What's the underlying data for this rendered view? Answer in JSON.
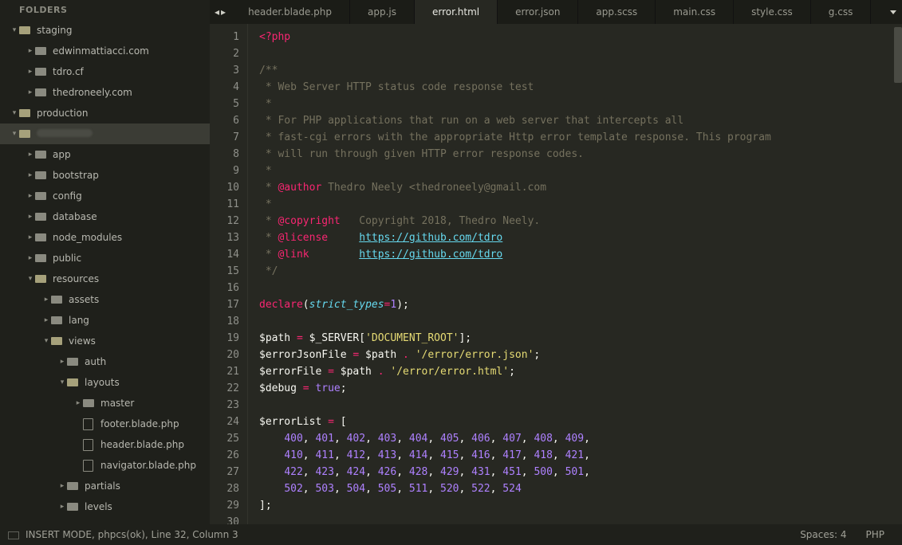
{
  "sidebar": {
    "header": "FOLDERS",
    "tree": [
      {
        "depth": 0,
        "type": "folder",
        "open": true,
        "label": "staging"
      },
      {
        "depth": 1,
        "type": "folder",
        "open": false,
        "label": "edwinmattiacci.com"
      },
      {
        "depth": 1,
        "type": "folder",
        "open": false,
        "label": "tdro.cf"
      },
      {
        "depth": 1,
        "type": "folder",
        "open": false,
        "label": "thedroneely.com"
      },
      {
        "depth": 0,
        "type": "folder",
        "open": true,
        "label": "production"
      },
      {
        "depth": 0,
        "type": "folder",
        "open": true,
        "label": "",
        "selected": true,
        "obscured": true
      },
      {
        "depth": 1,
        "type": "folder",
        "open": false,
        "label": "app"
      },
      {
        "depth": 1,
        "type": "folder",
        "open": false,
        "label": "bootstrap"
      },
      {
        "depth": 1,
        "type": "folder",
        "open": false,
        "label": "config"
      },
      {
        "depth": 1,
        "type": "folder",
        "open": false,
        "label": "database"
      },
      {
        "depth": 1,
        "type": "folder",
        "open": false,
        "label": "node_modules"
      },
      {
        "depth": 1,
        "type": "folder",
        "open": false,
        "label": "public"
      },
      {
        "depth": 1,
        "type": "folder",
        "open": true,
        "label": "resources"
      },
      {
        "depth": 2,
        "type": "folder",
        "open": false,
        "label": "assets"
      },
      {
        "depth": 2,
        "type": "folder",
        "open": false,
        "label": "lang"
      },
      {
        "depth": 2,
        "type": "folder",
        "open": true,
        "label": "views"
      },
      {
        "depth": 3,
        "type": "folder",
        "open": false,
        "label": "auth"
      },
      {
        "depth": 3,
        "type": "folder",
        "open": true,
        "label": "layouts"
      },
      {
        "depth": 4,
        "type": "folder",
        "open": false,
        "label": "master"
      },
      {
        "depth": 4,
        "type": "file",
        "label": "footer.blade.php"
      },
      {
        "depth": 4,
        "type": "file",
        "label": "header.blade.php"
      },
      {
        "depth": 4,
        "type": "file",
        "label": "navigator.blade.php"
      },
      {
        "depth": 3,
        "type": "folder",
        "open": false,
        "label": "partials"
      },
      {
        "depth": 3,
        "type": "folder",
        "open": false,
        "label": "levels"
      }
    ]
  },
  "tabs": {
    "nav_prev": "◂",
    "nav_next": "▸",
    "items": [
      {
        "label": "header.blade.php",
        "active": false
      },
      {
        "label": "app.js",
        "active": false
      },
      {
        "label": "error.html",
        "active": true
      },
      {
        "label": "error.json",
        "active": false
      },
      {
        "label": "app.scss",
        "active": false
      },
      {
        "label": "main.css",
        "active": false
      },
      {
        "label": "style.css",
        "active": false
      },
      {
        "label": "g.css",
        "active": false
      }
    ]
  },
  "code": {
    "first_line": 1,
    "lines": [
      [
        {
          "c": "c-tag",
          "t": "<?php"
        }
      ],
      [],
      [
        {
          "c": "c-cmt",
          "t": "/**"
        }
      ],
      [
        {
          "c": "c-cmt",
          "t": " * Web Server HTTP status code response test"
        }
      ],
      [
        {
          "c": "c-cmt",
          "t": " *"
        }
      ],
      [
        {
          "c": "c-cmt",
          "t": " * For PHP applications that run on a web server that intercepts all"
        }
      ],
      [
        {
          "c": "c-cmt",
          "t": " * fast-cgi errors with the appropriate Http error template response. This program"
        }
      ],
      [
        {
          "c": "c-cmt",
          "t": " * will run through given HTTP error response codes."
        }
      ],
      [
        {
          "c": "c-cmt",
          "t": " *"
        }
      ],
      [
        {
          "c": "c-cmt",
          "t": " * "
        },
        {
          "c": "c-doc",
          "t": "@author"
        },
        {
          "c": "c-cmt",
          "t": " Thedro Neely <thedroneely@gmail.com"
        }
      ],
      [
        {
          "c": "c-cmt",
          "t": " *"
        }
      ],
      [
        {
          "c": "c-cmt",
          "t": " * "
        },
        {
          "c": "c-doc",
          "t": "@copyright"
        },
        {
          "c": "c-cmt",
          "t": "   Copyright 2018, Thedro Neely."
        }
      ],
      [
        {
          "c": "c-cmt",
          "t": " * "
        },
        {
          "c": "c-doc",
          "t": "@license"
        },
        {
          "c": "c-cmt",
          "t": "     "
        },
        {
          "c": "c-link",
          "t": "https://github.com/tdro"
        }
      ],
      [
        {
          "c": "c-cmt",
          "t": " * "
        },
        {
          "c": "c-doc",
          "t": "@link"
        },
        {
          "c": "c-cmt",
          "t": "        "
        },
        {
          "c": "c-link",
          "t": "https://github.com/tdro"
        }
      ],
      [
        {
          "c": "c-cmt",
          "t": " */"
        }
      ],
      [],
      [
        {
          "c": "c-tag",
          "t": "declare"
        },
        {
          "c": "c-plain",
          "t": "("
        },
        {
          "c": "c-kw",
          "t": "strict_types"
        },
        {
          "c": "c-op",
          "t": "="
        },
        {
          "c": "c-num",
          "t": "1"
        },
        {
          "c": "c-plain",
          "t": ");"
        }
      ],
      [],
      [
        {
          "c": "c-plain",
          "t": "$path "
        },
        {
          "c": "c-op",
          "t": "="
        },
        {
          "c": "c-plain",
          "t": " $_SERVER["
        },
        {
          "c": "c-str",
          "t": "'DOCUMENT_ROOT'"
        },
        {
          "c": "c-plain",
          "t": "];"
        }
      ],
      [
        {
          "c": "c-plain",
          "t": "$errorJsonFile "
        },
        {
          "c": "c-op",
          "t": "="
        },
        {
          "c": "c-plain",
          "t": " $path "
        },
        {
          "c": "c-op",
          "t": "."
        },
        {
          "c": "c-plain",
          "t": " "
        },
        {
          "c": "c-str",
          "t": "'/error/error.json'"
        },
        {
          "c": "c-plain",
          "t": ";"
        }
      ],
      [
        {
          "c": "c-plain",
          "t": "$errorFile "
        },
        {
          "c": "c-op",
          "t": "="
        },
        {
          "c": "c-plain",
          "t": " $path "
        },
        {
          "c": "c-op",
          "t": "."
        },
        {
          "c": "c-plain",
          "t": " "
        },
        {
          "c": "c-str",
          "t": "'/error/error.html'"
        },
        {
          "c": "c-plain",
          "t": ";"
        }
      ],
      [
        {
          "c": "c-plain",
          "t": "$debug "
        },
        {
          "c": "c-op",
          "t": "="
        },
        {
          "c": "c-plain",
          "t": " "
        },
        {
          "c": "c-num",
          "t": "true"
        },
        {
          "c": "c-plain",
          "t": ";"
        }
      ],
      [],
      [
        {
          "c": "c-plain",
          "t": "$errorList "
        },
        {
          "c": "c-op",
          "t": "="
        },
        {
          "c": "c-plain",
          "t": " ["
        }
      ],
      [
        {
          "c": "c-plain",
          "t": "    "
        },
        {
          "c": "c-num",
          "t": "400"
        },
        {
          "c": "c-plain",
          "t": ", "
        },
        {
          "c": "c-num",
          "t": "401"
        },
        {
          "c": "c-plain",
          "t": ", "
        },
        {
          "c": "c-num",
          "t": "402"
        },
        {
          "c": "c-plain",
          "t": ", "
        },
        {
          "c": "c-num",
          "t": "403"
        },
        {
          "c": "c-plain",
          "t": ", "
        },
        {
          "c": "c-num",
          "t": "404"
        },
        {
          "c": "c-plain",
          "t": ", "
        },
        {
          "c": "c-num",
          "t": "405"
        },
        {
          "c": "c-plain",
          "t": ", "
        },
        {
          "c": "c-num",
          "t": "406"
        },
        {
          "c": "c-plain",
          "t": ", "
        },
        {
          "c": "c-num",
          "t": "407"
        },
        {
          "c": "c-plain",
          "t": ", "
        },
        {
          "c": "c-num",
          "t": "408"
        },
        {
          "c": "c-plain",
          "t": ", "
        },
        {
          "c": "c-num",
          "t": "409"
        },
        {
          "c": "c-plain",
          "t": ","
        }
      ],
      [
        {
          "c": "c-plain",
          "t": "    "
        },
        {
          "c": "c-num",
          "t": "410"
        },
        {
          "c": "c-plain",
          "t": ", "
        },
        {
          "c": "c-num",
          "t": "411"
        },
        {
          "c": "c-plain",
          "t": ", "
        },
        {
          "c": "c-num",
          "t": "412"
        },
        {
          "c": "c-plain",
          "t": ", "
        },
        {
          "c": "c-num",
          "t": "413"
        },
        {
          "c": "c-plain",
          "t": ", "
        },
        {
          "c": "c-num",
          "t": "414"
        },
        {
          "c": "c-plain",
          "t": ", "
        },
        {
          "c": "c-num",
          "t": "415"
        },
        {
          "c": "c-plain",
          "t": ", "
        },
        {
          "c": "c-num",
          "t": "416"
        },
        {
          "c": "c-plain",
          "t": ", "
        },
        {
          "c": "c-num",
          "t": "417"
        },
        {
          "c": "c-plain",
          "t": ", "
        },
        {
          "c": "c-num",
          "t": "418"
        },
        {
          "c": "c-plain",
          "t": ", "
        },
        {
          "c": "c-num",
          "t": "421"
        },
        {
          "c": "c-plain",
          "t": ","
        }
      ],
      [
        {
          "c": "c-plain",
          "t": "    "
        },
        {
          "c": "c-num",
          "t": "422"
        },
        {
          "c": "c-plain",
          "t": ", "
        },
        {
          "c": "c-num",
          "t": "423"
        },
        {
          "c": "c-plain",
          "t": ", "
        },
        {
          "c": "c-num",
          "t": "424"
        },
        {
          "c": "c-plain",
          "t": ", "
        },
        {
          "c": "c-num",
          "t": "426"
        },
        {
          "c": "c-plain",
          "t": ", "
        },
        {
          "c": "c-num",
          "t": "428"
        },
        {
          "c": "c-plain",
          "t": ", "
        },
        {
          "c": "c-num",
          "t": "429"
        },
        {
          "c": "c-plain",
          "t": ", "
        },
        {
          "c": "c-num",
          "t": "431"
        },
        {
          "c": "c-plain",
          "t": ", "
        },
        {
          "c": "c-num",
          "t": "451"
        },
        {
          "c": "c-plain",
          "t": ", "
        },
        {
          "c": "c-num",
          "t": "500"
        },
        {
          "c": "c-plain",
          "t": ", "
        },
        {
          "c": "c-num",
          "t": "501"
        },
        {
          "c": "c-plain",
          "t": ","
        }
      ],
      [
        {
          "c": "c-plain",
          "t": "    "
        },
        {
          "c": "c-num",
          "t": "502"
        },
        {
          "c": "c-plain",
          "t": ", "
        },
        {
          "c": "c-num",
          "t": "503"
        },
        {
          "c": "c-plain",
          "t": ", "
        },
        {
          "c": "c-num",
          "t": "504"
        },
        {
          "c": "c-plain",
          "t": ", "
        },
        {
          "c": "c-num",
          "t": "505"
        },
        {
          "c": "c-plain",
          "t": ", "
        },
        {
          "c": "c-num",
          "t": "511"
        },
        {
          "c": "c-plain",
          "t": ", "
        },
        {
          "c": "c-num",
          "t": "520"
        },
        {
          "c": "c-plain",
          "t": ", "
        },
        {
          "c": "c-num",
          "t": "522"
        },
        {
          "c": "c-plain",
          "t": ", "
        },
        {
          "c": "c-num",
          "t": "524"
        }
      ],
      [
        {
          "c": "c-plain",
          "t": "];"
        }
      ],
      []
    ]
  },
  "status": {
    "left": "INSERT MODE, phpcs(ok), Line 32, Column 3",
    "spaces": "Spaces: 4",
    "lang": "PHP"
  }
}
